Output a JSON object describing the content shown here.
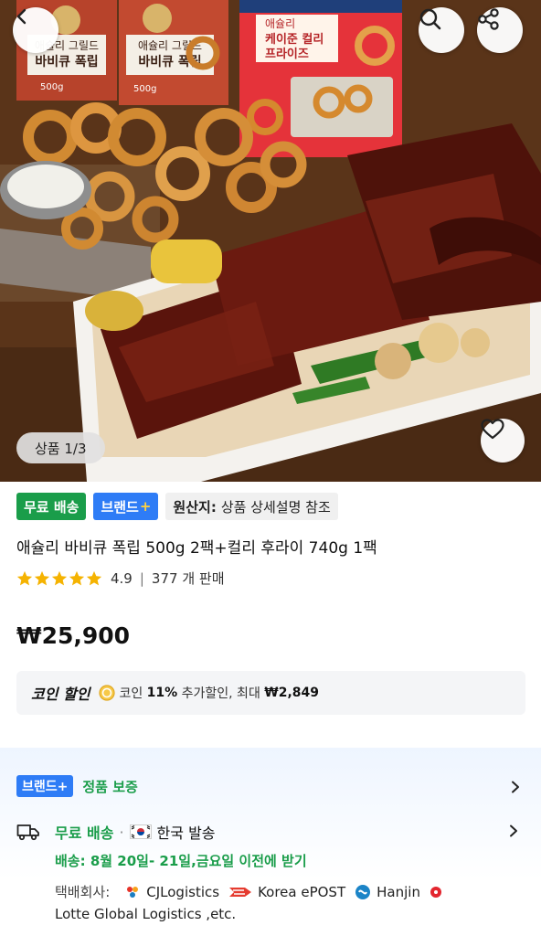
{
  "hero": {
    "image_counter": "상품 1/3",
    "package1": {
      "brand": "애슐리 그릴드",
      "name": "바비큐 폭립",
      "weight": "500g"
    },
    "package2": {
      "brand": "애슐리 그릴드",
      "name": "바비큐 폭립",
      "weight": "500g"
    },
    "package3": {
      "brand": "애슐리",
      "name_line1": "케이준 컬리",
      "name_line2": "프라이즈"
    }
  },
  "badges": {
    "free_shipping": "무료 배송",
    "brand": "브랜드",
    "brand_plus": "+",
    "origin_label": "원산지:",
    "origin_value": "상품 상세설명 참조"
  },
  "product": {
    "title": "애슐리 바비큐 폭립 500g 2팩+컬리 후라이 740g 1팩",
    "rating": "4.9",
    "sales": "377 개 판매",
    "price": "₩25,900"
  },
  "coin": {
    "title": "코인 할인",
    "text_prefix": "코인",
    "percent": "11%",
    "text_mid": "추가할인, 최대",
    "max": "₩2,849"
  },
  "brand_guarantee": {
    "tag": "브랜드+",
    "text": "정품 보증"
  },
  "shipping": {
    "free": "무료 배송",
    "origin": "한국 발송",
    "eta": "배송: 8월 20일- 21일,금요일 이전에 받기",
    "carrier_label": "택배회사:",
    "carriers": [
      "CJLogistics",
      "Korea ePOST",
      "Hanjin",
      "Lotte Global Logistics ,etc."
    ]
  },
  "colors": {
    "green": "#1a9d4a",
    "blue": "#2e7cf6",
    "star": "#f5b301"
  }
}
